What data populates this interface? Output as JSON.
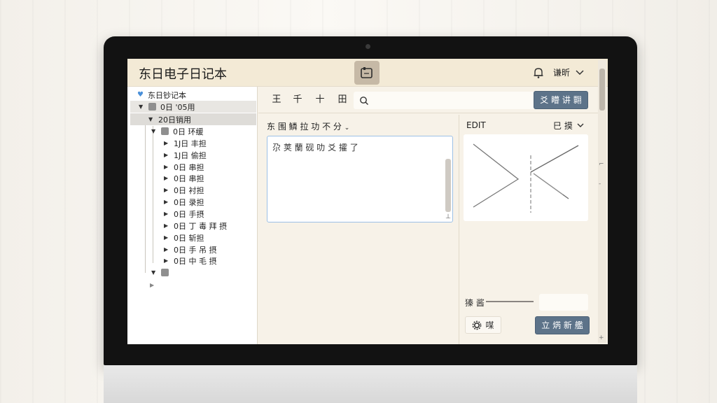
{
  "app": {
    "title": "东日电子日记本",
    "user_label": "谦昕"
  },
  "sidebar": {
    "rows": [
      {
        "label": "东日钞记本",
        "marker": "♥"
      },
      {
        "label": "0日 '05用",
        "marker": "▼"
      },
      {
        "label": "20日销用",
        "marker": "▼"
      },
      {
        "label": "0日 环缓",
        "marker": "▼"
      },
      {
        "label": "1J日 丰担",
        "marker": "▶"
      },
      {
        "label": "1J日 偷担",
        "marker": "▶"
      },
      {
        "label": "0日 串担",
        "marker": "▶"
      },
      {
        "label": "0日 串担",
        "marker": "▶"
      },
      {
        "label": "0日 衬担",
        "marker": "▶"
      },
      {
        "label": "0日 录担",
        "marker": "▶"
      },
      {
        "label": "0日 手摂",
        "marker": "▶"
      },
      {
        "label": "0日 丁 毒 拜 摂",
        "marker": "▶"
      },
      {
        "label": "0日 斩担",
        "marker": "▶"
      },
      {
        "label": "0日 手 吊 摂",
        "marker": "▶"
      },
      {
        "label": "0日 中 毛 摂",
        "marker": "▶"
      },
      {
        "label": "",
        "marker": "▼"
      },
      {
        "label": "",
        "marker": "▶"
      }
    ]
  },
  "toolbar": {
    "buttons": [
      "王",
      "千",
      "十",
      "田"
    ],
    "search_placeholder": "",
    "action_label": "爻 矒 讲 翾"
  },
  "editor": {
    "header_label": "东 围 鳞 拉  功 不 分",
    "content": "尕 荚 蘭 砚 叻 爻 攉 了"
  },
  "right_panel": {
    "title": "EDIT",
    "menu_label": "巳 摸",
    "slider_label": "獉 酱",
    "small_button_label": "㖼",
    "primary_label": "立 焫 新 艦"
  },
  "colors": {
    "accent": "#5d7389",
    "titlebar": "#f3ead6",
    "screen_bg": "#f7f2e8",
    "focus_border": "#9cc0e6"
  }
}
